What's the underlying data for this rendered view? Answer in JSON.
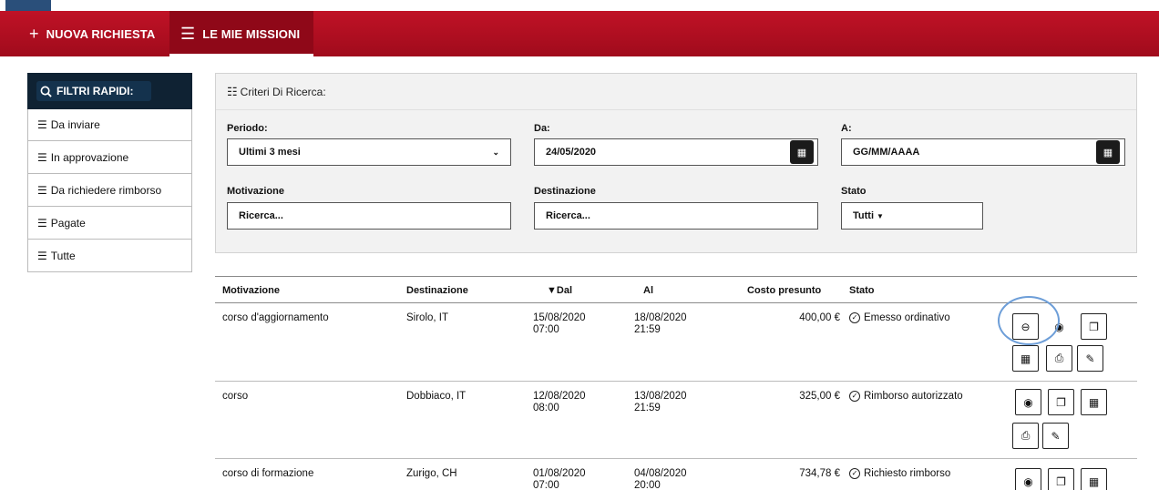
{
  "nav": {
    "new_request": "NUOVA RICHIESTA",
    "my_missions": "LE MIE MISSIONI"
  },
  "quick_filters": {
    "title": "FILTRI RAPIDI:",
    "items": [
      {
        "label": "Da inviare"
      },
      {
        "label": "In approvazione"
      },
      {
        "label": "Da richiedere rimborso"
      },
      {
        "label": "Pagate"
      },
      {
        "label": "Tutte"
      }
    ]
  },
  "criteria": {
    "title": "Criteri Di Ricerca:",
    "period_label": "Periodo:",
    "period_value": "Ultimi 3 mesi",
    "from_label": "Da:",
    "from_value": "24/05/2020",
    "to_label": "A:",
    "to_value": "GG/MM/AAAA",
    "motivation_label": "Motivazione",
    "motivation_value": "Ricerca...",
    "destination_label": "Destinazione",
    "destination_value": "Ricerca...",
    "state_label": "Stato",
    "state_value": "Tutti"
  },
  "table": {
    "headers": {
      "motivation": "Motivazione",
      "destination": "Destinazione",
      "from": "▼Dal",
      "to": "Al",
      "cost": "Costo presunto",
      "state": "Stato"
    },
    "rows": [
      {
        "motivation": "corso d'aggiornamento",
        "destination": "Sirolo, IT",
        "from_date": "15/08/2020",
        "from_time": "07:00",
        "to_date": "18/08/2020",
        "to_time": "21:59",
        "cost": "400,00 €",
        "state": "Emesso ordinativo"
      },
      {
        "motivation": "corso",
        "destination": "Dobbiaco, IT",
        "from_date": "12/08/2020",
        "from_time": "08:00",
        "to_date": "13/08/2020",
        "to_time": "21:59",
        "cost": "325,00 €",
        "state": "Rimborso autorizzato"
      },
      {
        "motivation": "corso di formazione",
        "destination": "Zurigo, CH",
        "from_date": "01/08/2020",
        "from_time": "07:00",
        "to_date": "04/08/2020",
        "to_time": "20:00",
        "cost": "734,78 €",
        "state": "Richiesto rimborso"
      }
    ]
  },
  "colors": {
    "nav_red": "#b80f22",
    "nav_active": "#8f0818",
    "filter_header": "#0f2233",
    "highlight_circle": "#6d9ed8"
  },
  "icons": {
    "add": "plus-icon",
    "list": "list-icon",
    "search": "search-icon",
    "sliders": "sliders-icon",
    "calendar": "calendar-icon",
    "view": "eye-icon",
    "copy": "copy-icon",
    "print": "printer-icon",
    "attach": "paperclip-icon",
    "ticket": "ticket-icon",
    "check": "check-circle-icon"
  }
}
